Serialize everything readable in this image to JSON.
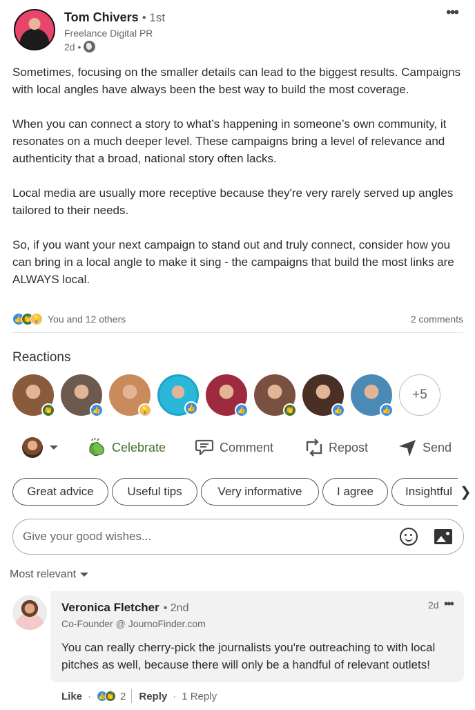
{
  "author": {
    "name": "Tom Chivers",
    "degree": "• 1st",
    "headline": "Freelance Digital PR",
    "time": "2d •",
    "visibility_icon": "globe-icon"
  },
  "post": {
    "paragraphs": [
      "Sometimes, focusing on the smaller details can lead to the biggest results. Campaigns with local angles have always been the best way to build the most coverage.",
      "When you can connect a story to what’s happening in someone’s own community, it resonates on a much deeper level. These campaigns bring a level of relevance and authenticity that a broad, national story often lacks.",
      "Local media are usually more receptive because they're very rarely served up angles tailored to their needs.",
      "So, if you want your next campaign to stand out and truly connect, consider how you can bring in a local angle to make it sing - the campaigns that build the most links are ALWAYS local."
    ]
  },
  "social": {
    "reaction_types": [
      "like",
      "celebrate",
      "insightful"
    ],
    "reactions_text": "You and 12 others",
    "comments_text": "2 comments"
  },
  "reactions": {
    "title": "Reactions",
    "reactors": [
      {
        "reaction": "celebrate",
        "color": "#8a5a3c"
      },
      {
        "reaction": "like",
        "color": "#6d5a4e"
      },
      {
        "reaction": "insightful",
        "color": "#c98a5c"
      },
      {
        "reaction": "like",
        "color": "#2ab7d8"
      },
      {
        "reaction": "like",
        "color": "#9e2a3f"
      },
      {
        "reaction": "celebrate",
        "color": "#7a5040"
      },
      {
        "reaction": "like",
        "color": "#4a2f25"
      },
      {
        "reaction": "like",
        "color": "#4a8ab5"
      }
    ],
    "more_label": "+5"
  },
  "actions": {
    "celebrate": "Celebrate",
    "comment": "Comment",
    "repost": "Repost",
    "send": "Send"
  },
  "quick_replies": [
    "Great advice",
    "Useful tips",
    "Very informative",
    "I agree",
    "Insightful"
  ],
  "comment_input": {
    "placeholder": "Give your good wishes..."
  },
  "sort": {
    "label": "Most relevant"
  },
  "comment": {
    "name": "Veronica Fletcher",
    "degree": "• 2nd",
    "headline": "Co-Founder @ JournoFinder.com",
    "time": "2d",
    "text": "You can really cherry-pick the journalists you're outreaching to with local pitches as well, because there will only be a handful of relevant outlets!",
    "like_label": "Like",
    "reaction_count": "2",
    "reply_label": "Reply",
    "replies_label": "1 Reply"
  },
  "colors": {
    "like": "#378fe9",
    "celebrate": "#44712e",
    "insightful": "#f5bb5c"
  }
}
